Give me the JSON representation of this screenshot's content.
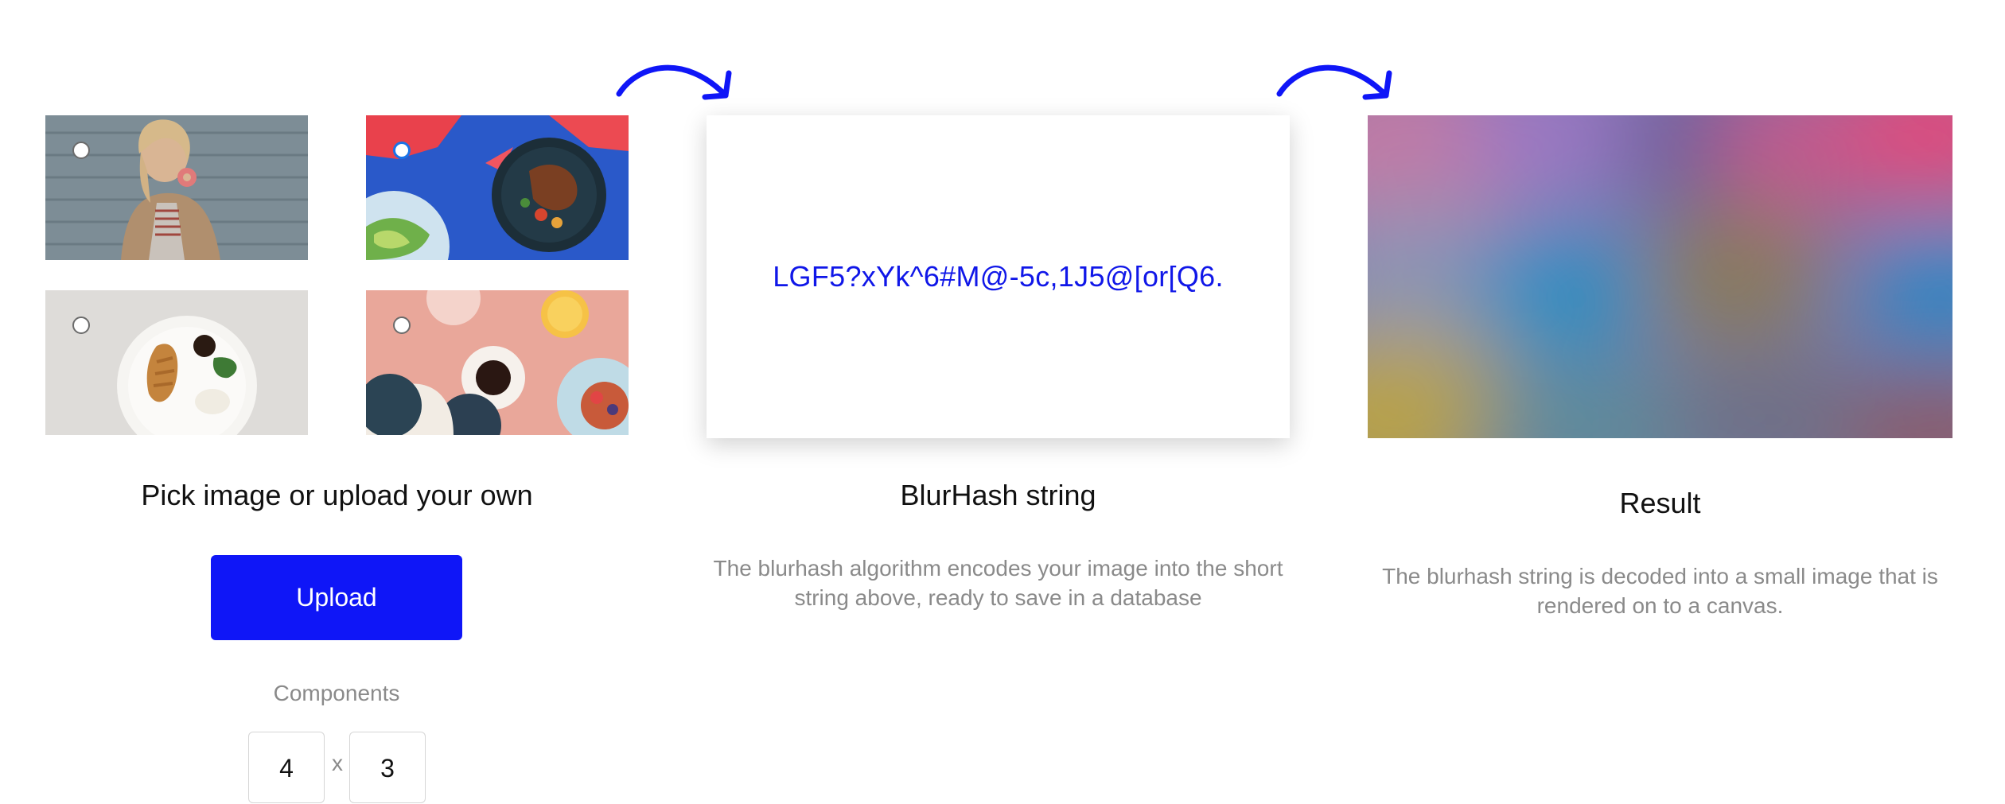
{
  "picker": {
    "title": "Pick image or upload your own",
    "upload_label": "Upload",
    "components_label": "Components",
    "components_x": "4",
    "components_separator": "x",
    "components_y": "3",
    "selected_image": 1,
    "images": [
      {
        "subject": "woman-eating-donut",
        "selected": false
      },
      {
        "subject": "steak-plate-on-blue",
        "selected": true
      },
      {
        "subject": "plate-with-chicken",
        "selected": false
      },
      {
        "subject": "coffee-and-breakfast",
        "selected": false
      }
    ]
  },
  "hash": {
    "value": "LGF5?xYk^6#M@-5c,1J5@[or[Q6.",
    "title": "BlurHash string",
    "description": "The blurhash algorithm encodes your image into the short string above, ready to save in a database"
  },
  "result": {
    "title": "Result",
    "description": "The blurhash string is decoded into a small image that is rendered on to a canvas."
  },
  "colors": {
    "accent": "#0f16f7",
    "hash_text": "#1017e8",
    "radio_selected": "#1a73e8",
    "muted_text": "#8a8a8a"
  },
  "icons": [
    "curved-arrow-icon"
  ]
}
